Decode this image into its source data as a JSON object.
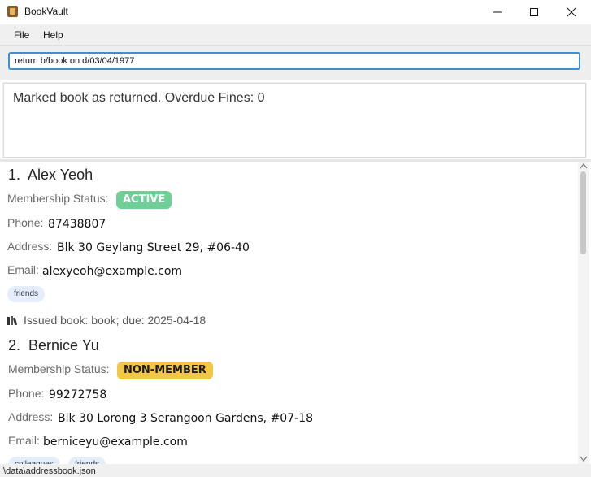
{
  "window": {
    "title": "BookVault",
    "icon": "bookvault-app-icon"
  },
  "menu": {
    "file": "File",
    "help": "Help"
  },
  "command": {
    "value": "return b/book on d/03/04/1977"
  },
  "result": {
    "message": "Marked book as returned. Overdue Fines: 0"
  },
  "persons": [
    {
      "index": "1.",
      "name": "Alex Yeoh",
      "membership_label": "Membership Status:",
      "membership": "ACTIVE",
      "phone_label": "Phone:",
      "phone": "87438807",
      "address_label": "Address:",
      "address": "Blk 30 Geylang Street 29, #06-40",
      "email_label": "Email:",
      "email": "alexyeoh@example.com",
      "tags": [
        "friends"
      ],
      "issued": "Issued book: book; due: 2025-04-18"
    },
    {
      "index": "2.",
      "name": "Bernice Yu",
      "membership_label": "Membership Status:",
      "membership": "NON-MEMBER",
      "phone_label": "Phone:",
      "phone": "99272758",
      "address_label": "Address:",
      "address": "Blk 30 Lorong 3 Serangoon Gardens, #07-18",
      "email_label": "Email:",
      "email": "berniceyu@example.com",
      "tags": [
        "colleagues",
        "friends"
      ]
    }
  ],
  "status": {
    "path": ".\\data\\addressbook.json"
  },
  "colors": {
    "active_badge": "#6fcf97",
    "nonmember_badge": "#f2c744",
    "tag_bg": "#e3eefa",
    "input_border": "#3d8fd1"
  }
}
